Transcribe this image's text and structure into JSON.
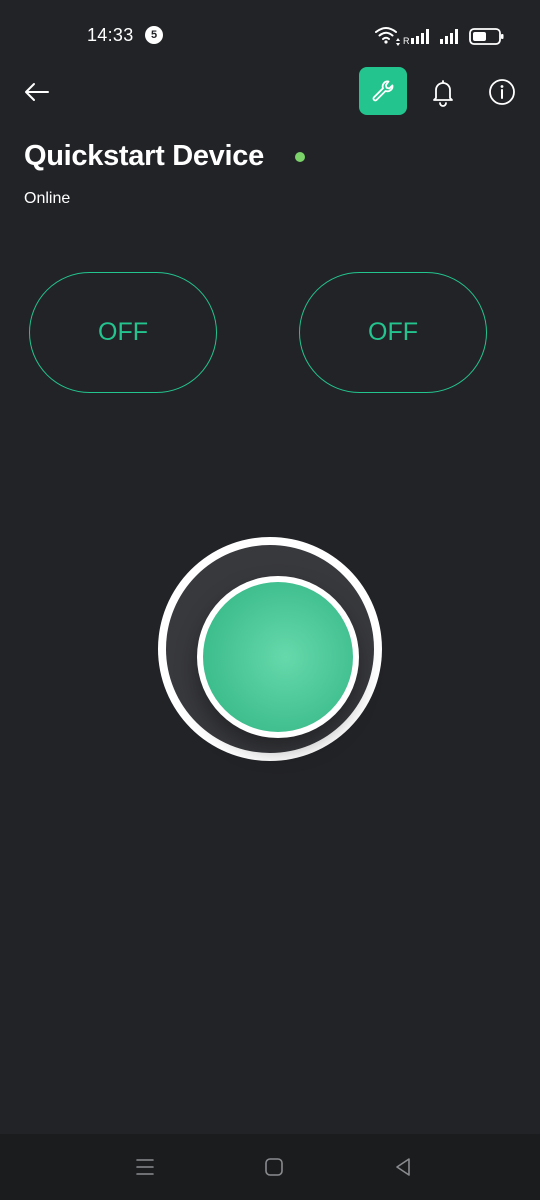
{
  "status_bar": {
    "time": "14:33",
    "notification_count": "5",
    "icons": [
      "wifi-icon",
      "signal-roaming-icon",
      "signal-icon",
      "battery-icon"
    ]
  },
  "header": {
    "icons": [
      "back-arrow-icon",
      "wrench-icon",
      "bell-icon",
      "info-icon"
    ],
    "accent_color": "#23c48e"
  },
  "device": {
    "name": "Quickstart Device",
    "status": "Online",
    "status_dot_color": "#7bd36a"
  },
  "widgets": {
    "switches": [
      {
        "label": "OFF"
      },
      {
        "label": "OFF"
      }
    ],
    "main_button_color": "#4fca9b"
  },
  "nav_bar": {
    "icons": [
      "recent-apps-icon",
      "home-icon",
      "back-icon"
    ]
  },
  "colors": {
    "background": "#222327",
    "accent": "#23c48e"
  }
}
